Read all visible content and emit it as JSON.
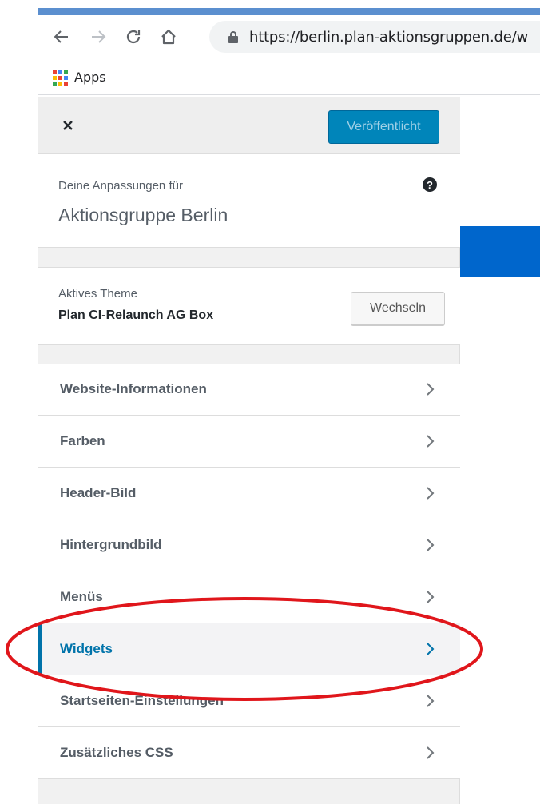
{
  "browser": {
    "url": "https://berlin.plan-aktionsgruppen.de/w",
    "bookmarks": {
      "apps_label": "Apps"
    },
    "icons": [
      "back-icon",
      "forward-icon",
      "reload-icon",
      "home-icon",
      "lock-icon",
      "apps-grid-icon"
    ]
  },
  "customizer": {
    "close_icon": "close-icon",
    "publish_label": "Veröffentlicht",
    "info": {
      "prefix": "Deine Anpassungen für",
      "site_title": "Aktionsgruppe Berlin",
      "help_icon": "?"
    },
    "theme": {
      "label": "Aktives Theme",
      "name": "Plan CI-Relaunch AG Box",
      "change_label": "Wechseln"
    },
    "menu": [
      {
        "label": "Website-Informationen",
        "active": false
      },
      {
        "label": "Farben",
        "active": false
      },
      {
        "label": "Header-Bild",
        "active": false
      },
      {
        "label": "Hintergrundbild",
        "active": false
      },
      {
        "label": "Menüs",
        "active": false
      },
      {
        "label": "Widgets",
        "active": true
      },
      {
        "label": "Startseiten-Einstellungen",
        "active": false
      },
      {
        "label": "Zusätzliches CSS",
        "active": false
      }
    ]
  },
  "colors": {
    "accent": "#0073aa",
    "publish_button": "#0085ba",
    "annotation": "#e0161b",
    "preview_bar": "#0066cc"
  }
}
